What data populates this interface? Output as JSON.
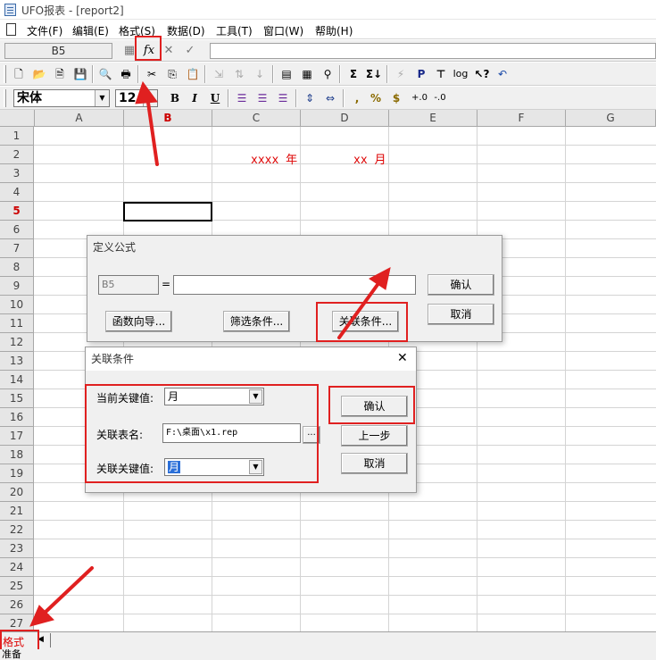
{
  "window": {
    "title": "UFO报表 - [report2]"
  },
  "menu": [
    "文件(F)",
    "编辑(E)",
    "格式(S)",
    "数据(D)",
    "工具(T)",
    "窗口(W)",
    "帮助(H)"
  ],
  "formula_bar": {
    "cell_name": "B5",
    "fx_label": "fx",
    "cancel_glyph": "✕",
    "confirm_glyph": "✓"
  },
  "format_toolbar": {
    "font": "宋体",
    "size": "12",
    "bold": "B",
    "italic": "I",
    "underline": "U",
    "comma": ",",
    "percent": "%",
    "currency": "$"
  },
  "columns": [
    "A",
    "B",
    "C",
    "D",
    "E",
    "F",
    "G"
  ],
  "rows": [
    "1",
    "2",
    "3",
    "4",
    "5",
    "6",
    "7",
    "8",
    "9",
    "10",
    "11",
    "12",
    "13",
    "14",
    "15",
    "16",
    "17",
    "18",
    "19",
    "20",
    "21",
    "22",
    "23",
    "24",
    "25",
    "26",
    "27"
  ],
  "cells": {
    "c2": "xxxx 年",
    "d2": "xx 月"
  },
  "define_formula_dialog": {
    "title": "定义公式",
    "cell_ref": "B5",
    "equals": "=",
    "formula": "",
    "btn_function_wizard": "函数向导...",
    "btn_filter": "筛选条件...",
    "btn_relation": "关联条件...",
    "btn_ok": "确认",
    "btn_cancel": "取消"
  },
  "relation_dialog": {
    "title": "关联条件",
    "label_current_key": "当前关键值:",
    "current_key_value": "月",
    "label_table_name": "关联表名:",
    "table_name_value": "F:\\桌面\\x1.rep",
    "browse": "...",
    "label_related_key": "关联关键值:",
    "related_key_value": "月",
    "btn_ok": "确认",
    "btn_prev": "上一步",
    "btn_cancel": "取消"
  },
  "sheet_tab": "格式",
  "status": "准备",
  "colors": {
    "annotation_red": "#e02020",
    "cell_text_red": "#dd0000",
    "toolbar_bg": "#f0f0f0"
  }
}
